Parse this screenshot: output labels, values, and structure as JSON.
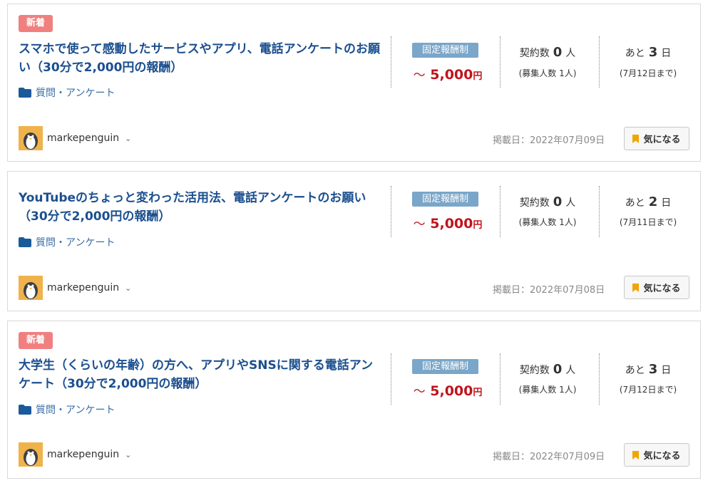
{
  "listings": [
    {
      "badge": "新着",
      "title": "スマホで使って感動したサービスやアプリ、電話アンケートのお願い（30分で2,000円の報酬）",
      "category": "質問・アンケート",
      "reward_type": "固定報酬制",
      "price_prefix": "～",
      "price": "5,000",
      "price_unit": "円",
      "contract_label": "契約数",
      "contract_count": "0",
      "contract_unit": "人",
      "recruit": "(募集人数 1人)",
      "remain_prefix": "あと",
      "remain_days": "3",
      "remain_unit": "日",
      "deadline": "(7月12日まで)",
      "username": "markepenguin",
      "posted": "掲載日：2022年07月09日",
      "bookmark_label": "気になる"
    },
    {
      "badge": "",
      "title": "YouTubeのちょっと変わった活用法、電話アンケートのお願い（30分で2,000円の報酬）",
      "category": "質問・アンケート",
      "reward_type": "固定報酬制",
      "price_prefix": "～",
      "price": "5,000",
      "price_unit": "円",
      "contract_label": "契約数",
      "contract_count": "0",
      "contract_unit": "人",
      "recruit": "(募集人数 1人)",
      "remain_prefix": "あと",
      "remain_days": "2",
      "remain_unit": "日",
      "deadline": "(7月11日まで)",
      "username": "markepenguin",
      "posted": "掲載日：2022年07月08日",
      "bookmark_label": "気になる"
    },
    {
      "badge": "新着",
      "title": "大学生（くらいの年齢）の方へ、アプリやSNSに関する電話アンケート（30分で2,000円の報酬）",
      "category": "質問・アンケート",
      "reward_type": "固定報酬制",
      "price_prefix": "～",
      "price": "5,000",
      "price_unit": "円",
      "contract_label": "契約数",
      "contract_count": "0",
      "contract_unit": "人",
      "recruit": "(募集人数 1人)",
      "remain_prefix": "あと",
      "remain_days": "3",
      "remain_unit": "日",
      "deadline": "(7月12日まで)",
      "username": "markepenguin",
      "posted": "掲載日：2022年07月09日",
      "bookmark_label": "気になる"
    }
  ],
  "colors": {
    "new_badge": "#f08080",
    "title": "#1b4f8f",
    "price": "#c0141c",
    "reward_tag": "#7aa6c9",
    "bookmark_icon": "#f0a500"
  },
  "icons": [
    "folder-icon",
    "bookmark-icon",
    "chevron-down-icon",
    "penguin-avatar"
  ]
}
